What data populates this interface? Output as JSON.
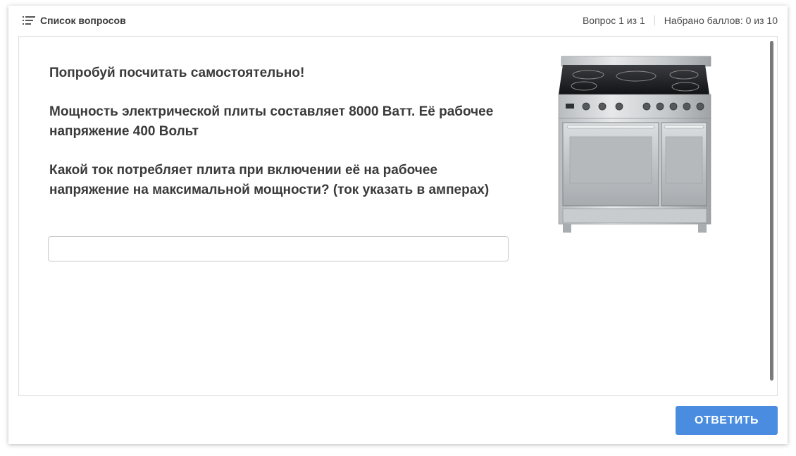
{
  "header": {
    "question_list_label": "Список вопросов",
    "question_counter": "Вопрос 1 из 1",
    "score": "Набрано баллов: 0 из 10"
  },
  "question": {
    "paragraphs": [
      "Попробуй посчитать самостоятельно!",
      "Мощность электрической плиты составляет 8000 Ватт. Её рабочее напряжение 400 Вольт",
      "Какой ток потребляет плита при включении её на рабочее напряжение на максимальной мощности? (ток указать в амперах)"
    ],
    "answer_value": "",
    "image": "electric-stove-image"
  },
  "footer": {
    "submit_label": "ОТВЕТИТЬ"
  },
  "colors": {
    "accent": "#4a8de0",
    "text": "#3a3a3a"
  },
  "icons": {
    "question_list": "list-icon"
  }
}
